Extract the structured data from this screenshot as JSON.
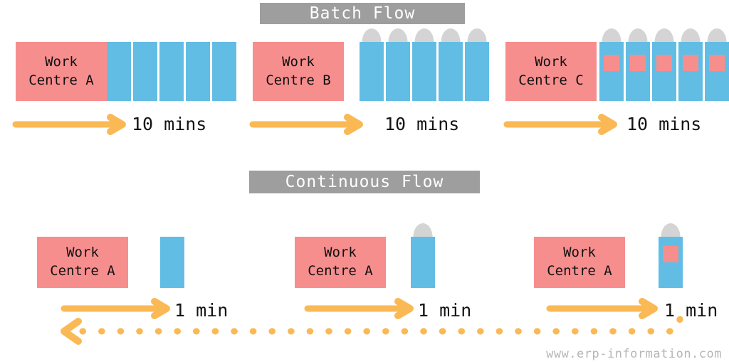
{
  "meta": {
    "watermark": "www.erp-information.com",
    "colors": {
      "pink": "#f78e8e",
      "blue": "#62bde5",
      "orange": "#fab955",
      "cap_gray": "#d4d4d4",
      "banner_gray": "#9e9e9e",
      "background": "#ffffff",
      "text": "#141414"
    }
  },
  "sections": [
    {
      "id": "batch-flow",
      "title": "Batch Flow",
      "stages": [
        {
          "id": "batch-stage-1",
          "work_centre_line1": "Work",
          "work_centre_line2": "Centre A",
          "time_label": "10 mins",
          "unit_count": 5,
          "has_cap": false,
          "has_label": false
        },
        {
          "id": "batch-stage-2",
          "work_centre_line1": "Work",
          "work_centre_line2": "Centre B",
          "time_label": "10 mins",
          "unit_count": 5,
          "has_cap": true,
          "has_label": false
        },
        {
          "id": "batch-stage-3",
          "work_centre_line1": "Work",
          "work_centre_line2": "Centre C",
          "time_label": "10 mins",
          "unit_count": 5,
          "has_cap": true,
          "has_label": true
        }
      ]
    },
    {
      "id": "continuous-flow",
      "title": "Continuous Flow",
      "stages": [
        {
          "id": "cont-stage-1",
          "work_centre_line1": "Work",
          "work_centre_line2": "Centre A",
          "time_label": "1 min",
          "unit_count": 1,
          "has_cap": false,
          "has_label": false
        },
        {
          "id": "cont-stage-2",
          "work_centre_line1": "Work",
          "work_centre_line2": "Centre A",
          "time_label": "1 min",
          "unit_count": 1,
          "has_cap": true,
          "has_label": false
        },
        {
          "id": "cont-stage-3",
          "work_centre_line1": "Work",
          "work_centre_line2": "Centre A",
          "time_label": "1 min",
          "unit_count": 1,
          "has_cap": true,
          "has_label": true
        }
      ],
      "feedback_loop": {
        "style": "dotted",
        "direction": "right-to-left",
        "icon": "dotted-return-arrow"
      }
    }
  ]
}
